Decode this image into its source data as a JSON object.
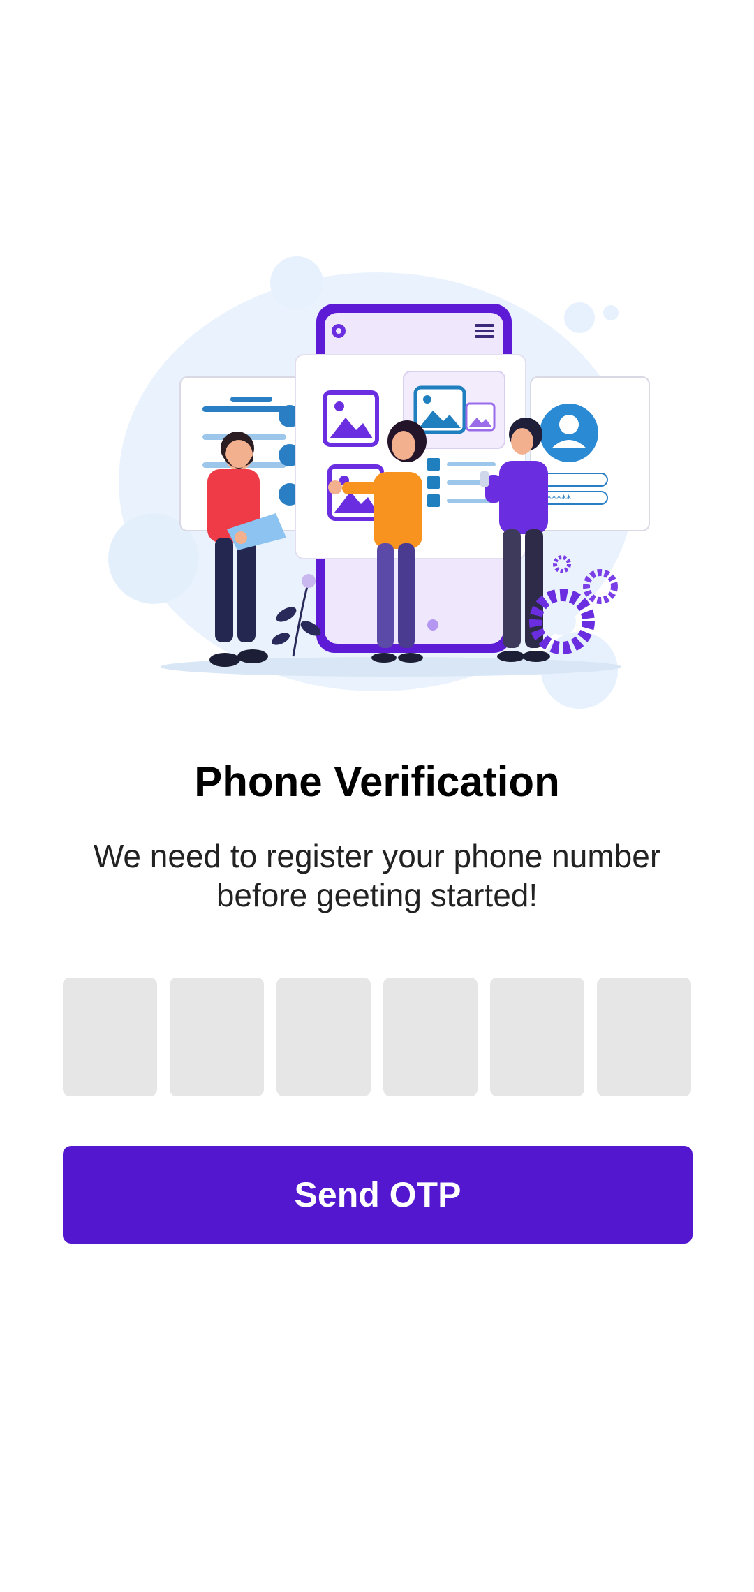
{
  "screen": {
    "title": "Phone Verification",
    "subtitle": "We need to register your phone number before geeting started!"
  },
  "otp": {
    "digit_count": 6,
    "values": [
      "",
      "",
      "",
      "",
      "",
      ""
    ]
  },
  "actions": {
    "send_label": "Send OTP"
  },
  "illustration": {
    "icon": "phone-verification-illustration"
  },
  "colors": {
    "primary": "#5417d0",
    "otp_box": "#e6e6e6",
    "title": "#000000",
    "subtitle": "#222222",
    "background": "#ffffff"
  }
}
